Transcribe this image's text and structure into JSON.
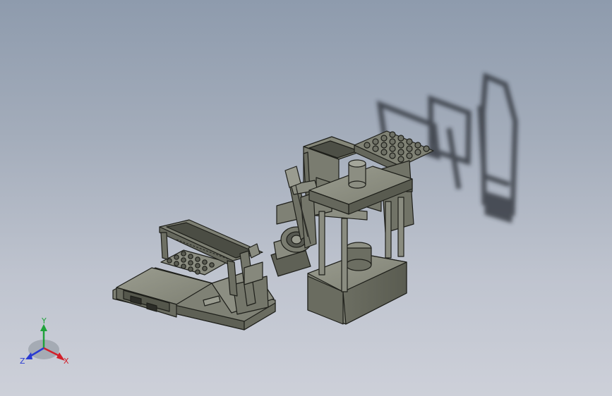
{
  "viewport": {
    "background_top": "#8e9bad",
    "background_bottom": "#cdd0d9",
    "model_fill": "#85877a",
    "model_edge": "#1e1f1a",
    "shadow": "#2a2d33"
  },
  "triad": {
    "x_label": "X",
    "y_label": "Y",
    "z_label": "Z",
    "x_color": "#d2202a",
    "y_color": "#1fa23a",
    "z_color": "#2a3bd2"
  }
}
